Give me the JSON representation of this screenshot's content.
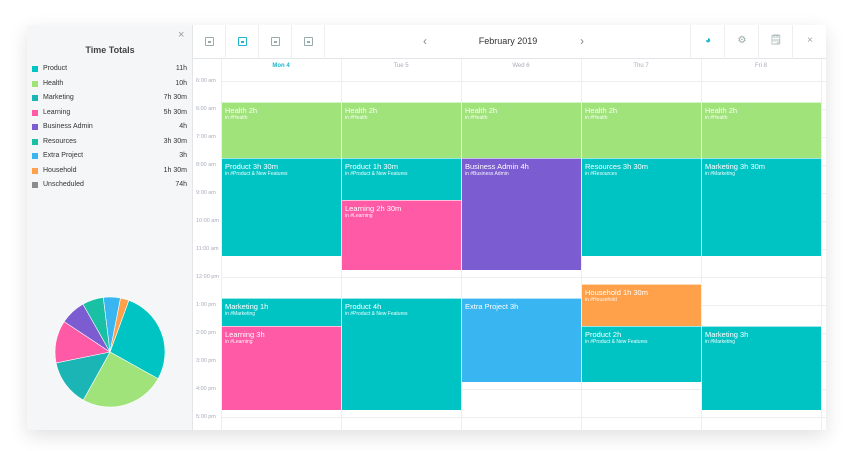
{
  "sidebar": {
    "title": "Time Totals",
    "close_glyph": "×",
    "items": [
      {
        "label": "Product",
        "value": "11h",
        "color": "#00c4c4"
      },
      {
        "label": "Health",
        "value": "10h",
        "color": "#9fe37a"
      },
      {
        "label": "Marketing",
        "value": "7h 30m",
        "color": "#1cb5b5"
      },
      {
        "label": "Learning",
        "value": "5h 30m",
        "color": "#ff5aa5"
      },
      {
        "label": "Business Admin",
        "value": "4h",
        "color": "#7b5cd1"
      },
      {
        "label": "Resources",
        "value": "3h 30m",
        "color": "#19c0a4"
      },
      {
        "label": "Extra Project",
        "value": "3h",
        "color": "#39b6f1"
      },
      {
        "label": "Household",
        "value": "1h 30m",
        "color": "#ffa04a"
      },
      {
        "label": "Unscheduled",
        "value": "74h",
        "color": "#8c8c8c"
      }
    ]
  },
  "toolbar": {
    "month": "February 2019",
    "prev_glyph": "‹",
    "next_glyph": "›",
    "pie_glyph": "◕",
    "settings_glyph": "⚙",
    "export_glyph": "🗒",
    "close_glyph": "×",
    "view_icons": [
      "day-view-icon",
      "week-view-icon",
      "month-view-icon",
      "year-view-icon"
    ]
  },
  "days": [
    "Mon 4",
    "Tue 5",
    "Wed 6",
    "Thu 7",
    "Fri 8"
  ],
  "hours": [
    "6:00 am",
    "6:00 am",
    "7:00 am",
    "8:00 am",
    "9:00 am",
    "10:00 am",
    "11:00 am",
    "12:00 pm",
    "1:00 pm",
    "2:00 pm",
    "3:00 pm",
    "4:00 pm",
    "5:00 pm"
  ],
  "events": [
    {
      "day": 0,
      "start": 6.0,
      "end": 8.0,
      "title": "Health 2h",
      "sub": "in #Health",
      "color": "#9fe37a"
    },
    {
      "day": 1,
      "start": 6.0,
      "end": 8.0,
      "title": "Health 2h",
      "sub": "in #Health",
      "color": "#9fe37a"
    },
    {
      "day": 2,
      "start": 6.0,
      "end": 8.0,
      "title": "Health 2h",
      "sub": "in #Health",
      "color": "#9fe37a"
    },
    {
      "day": 3,
      "start": 6.0,
      "end": 8.0,
      "title": "Health 2h",
      "sub": "in #Health",
      "color": "#9fe37a"
    },
    {
      "day": 4,
      "start": 6.0,
      "end": 8.0,
      "title": "Health 2h",
      "sub": "in #Health",
      "color": "#9fe37a"
    },
    {
      "day": 0,
      "start": 8.0,
      "end": 11.5,
      "title": "Product 3h 30m",
      "sub": "in #Product & New Features",
      "color": "#00c4c4"
    },
    {
      "day": 1,
      "start": 8.0,
      "end": 9.5,
      "title": "Product 1h 30m",
      "sub": "in #Product & New Features",
      "color": "#00c4c4"
    },
    {
      "day": 1,
      "start": 9.5,
      "end": 12.0,
      "title": "Learning 2h 30m",
      "sub": "in #Learning",
      "color": "#ff5aa5"
    },
    {
      "day": 2,
      "start": 8.0,
      "end": 12.0,
      "title": "Business Admin 4h",
      "sub": "in #Business Admin",
      "color": "#7b5cd1"
    },
    {
      "day": 3,
      "start": 8.0,
      "end": 11.5,
      "title": "Resources 3h 30m",
      "sub": "in #Resources",
      "color": "#00c4c4"
    },
    {
      "day": 4,
      "start": 8.0,
      "end": 11.5,
      "title": "Marketing 3h 30m",
      "sub": "in #Marketing",
      "color": "#00c4c4"
    },
    {
      "day": 0,
      "start": 13.0,
      "end": 14.0,
      "title": "Marketing 1h",
      "sub": "in #Marketing",
      "color": "#00c4c4"
    },
    {
      "day": 0,
      "start": 14.0,
      "end": 17.0,
      "title": "Learning 3h",
      "sub": "in #Learning",
      "color": "#ff5aa5"
    },
    {
      "day": 1,
      "start": 13.0,
      "end": 17.0,
      "title": "Product 4h",
      "sub": "in #Product & New Features",
      "color": "#00c4c4"
    },
    {
      "day": 2,
      "start": 13.0,
      "end": 16.0,
      "title": "Extra Project 3h",
      "sub": "",
      "color": "#39b6f1"
    },
    {
      "day": 3,
      "start": 12.5,
      "end": 14.0,
      "title": "Household 1h 30m",
      "sub": "in #Household",
      "color": "#ffa04a"
    },
    {
      "day": 3,
      "start": 14.0,
      "end": 16.0,
      "title": "Product 2h",
      "sub": "in #Product & New Features",
      "color": "#00c4c4"
    },
    {
      "day": 4,
      "start": 14.0,
      "end": 17.0,
      "title": "Marketing 3h",
      "sub": "in #Marketing",
      "color": "#00c4c4"
    }
  ],
  "pie": {
    "slices": [
      {
        "category": "Product",
        "hours": 22,
        "color": "#00c4c4"
      },
      {
        "category": "Health",
        "hours": 20,
        "color": "#9fe37a"
      },
      {
        "category": "Marketing",
        "hours": 11,
        "color": "#1cb5b5"
      },
      {
        "category": "Learning",
        "hours": 10,
        "color": "#ff5aa5"
      },
      {
        "category": "Business Admin",
        "hours": 6,
        "color": "#7b5cd1"
      },
      {
        "category": "Resources",
        "hours": 5,
        "color": "#19c0a4"
      },
      {
        "category": "Extra Project",
        "hours": 4,
        "color": "#39b6f1"
      },
      {
        "category": "Household",
        "hours": 2,
        "color": "#ffa04a"
      }
    ]
  }
}
